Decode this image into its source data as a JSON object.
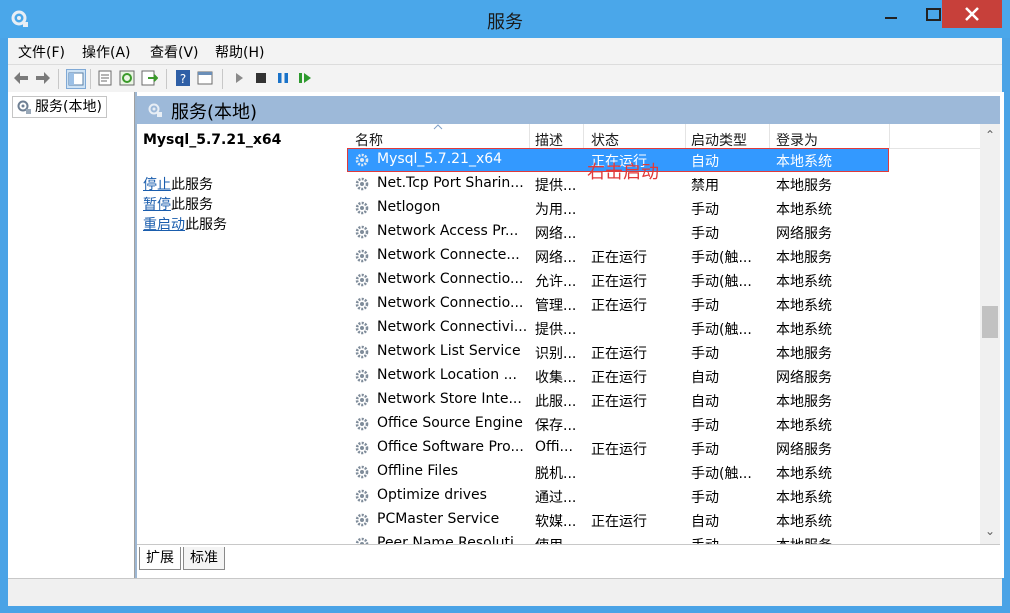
{
  "window": {
    "title": "服务"
  },
  "menu": [
    "文件(F)",
    "操作(A)",
    "查看(V)",
    "帮助(H)"
  ],
  "tree": {
    "item": "服务(本地)"
  },
  "pane": {
    "header": "服务(本地)"
  },
  "extended": {
    "service_name": "Mysql_5.7.21_x64",
    "stop_link": "停止",
    "stop_suffix": "此服务",
    "pause_link": "暂停",
    "pause_suffix": "此服务",
    "restart_link": "重启动",
    "restart_suffix": "此服务"
  },
  "columns": [
    "名称",
    "描述",
    "状态",
    "启动类型",
    "登录为"
  ],
  "services": [
    {
      "name": "Mysql_5.7.21_x64",
      "desc": "",
      "status": "正在运行",
      "startup": "自动",
      "logon": "本地系统",
      "selected": true
    },
    {
      "name": "Net.Tcp Port Sharin...",
      "desc": "提供...",
      "status": "",
      "startup": "禁用",
      "logon": "本地服务"
    },
    {
      "name": "Netlogon",
      "desc": "为用...",
      "status": "",
      "startup": "手动",
      "logon": "本地系统"
    },
    {
      "name": "Network Access Pr...",
      "desc": "网络...",
      "status": "",
      "startup": "手动",
      "logon": "网络服务"
    },
    {
      "name": "Network Connecte...",
      "desc": "网络...",
      "status": "正在运行",
      "startup": "手动(触...",
      "logon": "本地服务"
    },
    {
      "name": "Network Connectio...",
      "desc": "允许...",
      "status": "正在运行",
      "startup": "手动(触...",
      "logon": "本地系统"
    },
    {
      "name": "Network Connectio...",
      "desc": "管理...",
      "status": "正在运行",
      "startup": "手动",
      "logon": "本地系统"
    },
    {
      "name": "Network Connectivi...",
      "desc": "提供...",
      "status": "",
      "startup": "手动(触...",
      "logon": "本地系统"
    },
    {
      "name": "Network List Service",
      "desc": "识别...",
      "status": "正在运行",
      "startup": "手动",
      "logon": "本地服务"
    },
    {
      "name": "Network Location ...",
      "desc": "收集...",
      "status": "正在运行",
      "startup": "自动",
      "logon": "网络服务"
    },
    {
      "name": "Network Store Inte...",
      "desc": "此服...",
      "status": "正在运行",
      "startup": "自动",
      "logon": "本地服务"
    },
    {
      "name": "Office  Source Engine",
      "desc": "保存...",
      "status": "",
      "startup": "手动",
      "logon": "本地系统"
    },
    {
      "name": "Office Software Pro...",
      "desc": "Offi...",
      "status": "正在运行",
      "startup": "手动",
      "logon": "网络服务"
    },
    {
      "name": "Offline Files",
      "desc": "脱机...",
      "status": "",
      "startup": "手动(触...",
      "logon": "本地系统"
    },
    {
      "name": "Optimize drives",
      "desc": "通过...",
      "status": "",
      "startup": "手动",
      "logon": "本地系统"
    },
    {
      "name": "PCMaster Service",
      "desc": "软媒...",
      "status": "正在运行",
      "startup": "自动",
      "logon": "本地系统"
    },
    {
      "name": "Peer Name Resoluti...",
      "desc": "使用...",
      "status": "",
      "startup": "手动",
      "logon": "本地服务"
    }
  ],
  "annotation": "右击启动",
  "tabs": [
    "扩展",
    "标准"
  ],
  "colors": {
    "titlebar": "#4aa7ea",
    "selection": "#3399ff",
    "annotation": "#e03a3a",
    "close": "#c7403a"
  }
}
